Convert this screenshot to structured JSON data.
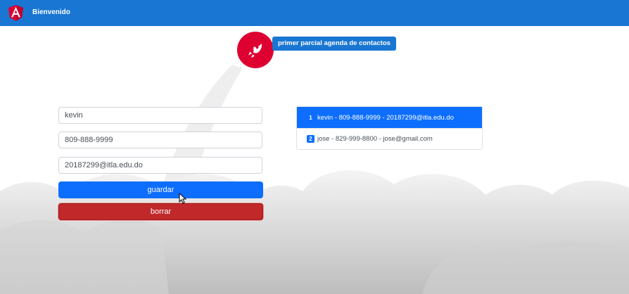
{
  "header": {
    "brand": "Bienvenido",
    "logo_icon": "angular-logo-icon",
    "color": "#1976d2"
  },
  "hero": {
    "icon": "rocket-icon",
    "title": "primer parcial agenda de contactos"
  },
  "form": {
    "name_value": "kevin",
    "phone_value": "809-888-9999",
    "email_value": "20187299@itla.edu.do",
    "save_label": "guardar",
    "delete_label": "borrar"
  },
  "contacts": [
    {
      "index": "1",
      "text": "kevin - 809-888-9999 - 20187299@itla.edu.do",
      "active": true
    },
    {
      "index": "2",
      "text": "jose - 829-999-8800 - jose@gmail.com",
      "active": false
    }
  ],
  "colors": {
    "primary": "#0d6efd",
    "danger": "#c0282a",
    "accent": "#dd0031"
  }
}
